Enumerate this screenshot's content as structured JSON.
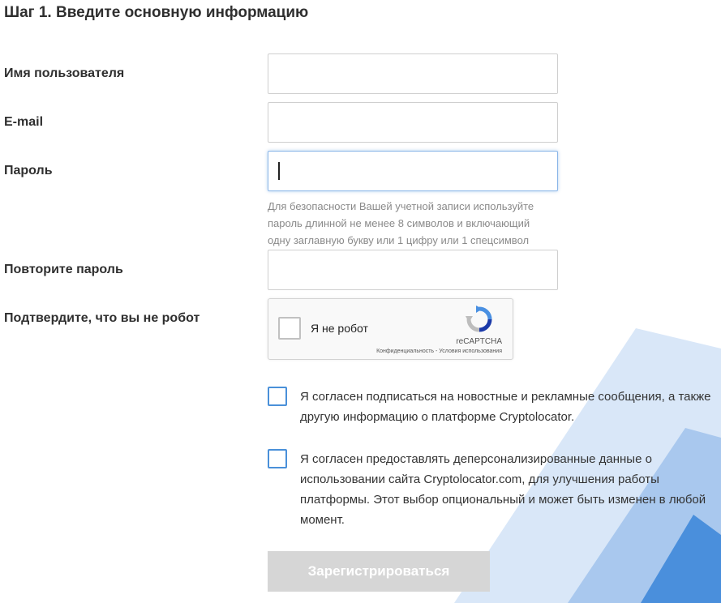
{
  "step_title": "Шаг 1. Введите основную информацию",
  "fields": {
    "username": {
      "label": "Имя пользователя",
      "value": ""
    },
    "email": {
      "label": "E-mail",
      "value": ""
    },
    "password": {
      "label": "Пароль",
      "value": "",
      "hint": [
        "Для безопасности Вашей учетной записи используйте",
        "пароль длинной не менее 8 символов и включающий",
        "одну заглавную букву или 1 цифру или 1 спецсимвол"
      ]
    },
    "password_repeat": {
      "label": "Повторите пароль",
      "value": ""
    }
  },
  "captcha": {
    "label": "Подтвердите, что вы не робот",
    "checkbox_label": "Я не робот",
    "brand": "reCAPTCHA",
    "links": "Конфиденциальность - Условия использования",
    "icon": "recaptcha-logo-icon"
  },
  "consents": [
    {
      "text": "Я согласен подписаться на новостные и рекламные сообщения, а также другую информацию о платформе Cryptolocator.",
      "checked": false
    },
    {
      "text": "Я согласен предоставлять деперсонализированные данные о использовании сайта Cryptolocator.com, для улучшения работы платформы. Этот выбор опциональный и может быть изменен в любой момент.",
      "checked": false
    }
  ],
  "submit": {
    "label": "Зарегистрироваться",
    "enabled": false
  },
  "colors": {
    "checkbox_border": "#4a90d9",
    "submit_disabled_bg": "#d6d6d6",
    "decor_light": "#d8e6f7",
    "decor_mid": "#a9c8ee",
    "decor_dark": "#4a8fdc"
  }
}
